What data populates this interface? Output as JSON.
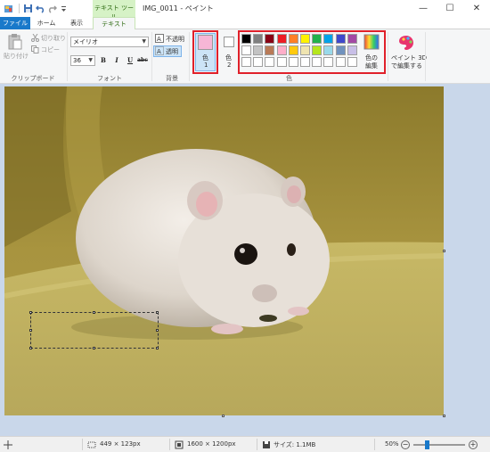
{
  "titlebar": {
    "title": "IMG_0011 - ペイント",
    "context_tool": "テキスト ツール",
    "minimize": "—",
    "maximize": "☐",
    "close": "✕"
  },
  "tabs": [
    {
      "label": "ファイル"
    },
    {
      "label": "ホーム"
    },
    {
      "label": "表示"
    },
    {
      "label": "テキスト"
    }
  ],
  "ribbon": {
    "clipboard": {
      "paste": "貼り付け",
      "cut": "切り取り",
      "copy": "コピー",
      "label": "クリップボード"
    },
    "font": {
      "family": "メイリオ",
      "size": "36",
      "bold": "B",
      "italic": "I",
      "underline": "U",
      "strike": "abc",
      "label": "フォント"
    },
    "background": {
      "opaque": "不透明",
      "transparent": "透明",
      "label": "背景"
    },
    "colors": {
      "color1_label": "色\n1",
      "color1_line1": "色",
      "color1_line2": "1",
      "color1_value": "#f6b6d6",
      "color2_line1": "色",
      "color2_line2": "2",
      "color2_value": "#ffffff",
      "edit_line1": "色の",
      "edit_line2": "編集",
      "label": "色",
      "palette_row1": [
        "#000000",
        "#7f7f7f",
        "#880015",
        "#ed1c24",
        "#ff7f27",
        "#fff200",
        "#22b14c",
        "#00a2e8",
        "#3f48cc",
        "#a349a4"
      ],
      "palette_row2": [
        "#ffffff",
        "#c3c3c3",
        "#b97a57",
        "#ffaec9",
        "#ffc90e",
        "#efe4b0",
        "#b5e61d",
        "#99d9ea",
        "#7092be",
        "#c8bfe7"
      ],
      "palette_row3": [
        "#ffffff",
        "#ffffff",
        "#ffffff",
        "#ffffff",
        "#ffffff",
        "#ffffff",
        "#ffffff",
        "#ffffff",
        "#ffffff",
        "#ffffff"
      ]
    },
    "paint3d": {
      "line1": "ペイント 3D",
      "line2": "で編集する"
    }
  },
  "status": {
    "selection_size": "449 × 123px",
    "image_size": "1600 × 1200px",
    "file_size": "サイズ: 1.1MB",
    "zoom": "50%",
    "zoom_level": 0.5
  }
}
